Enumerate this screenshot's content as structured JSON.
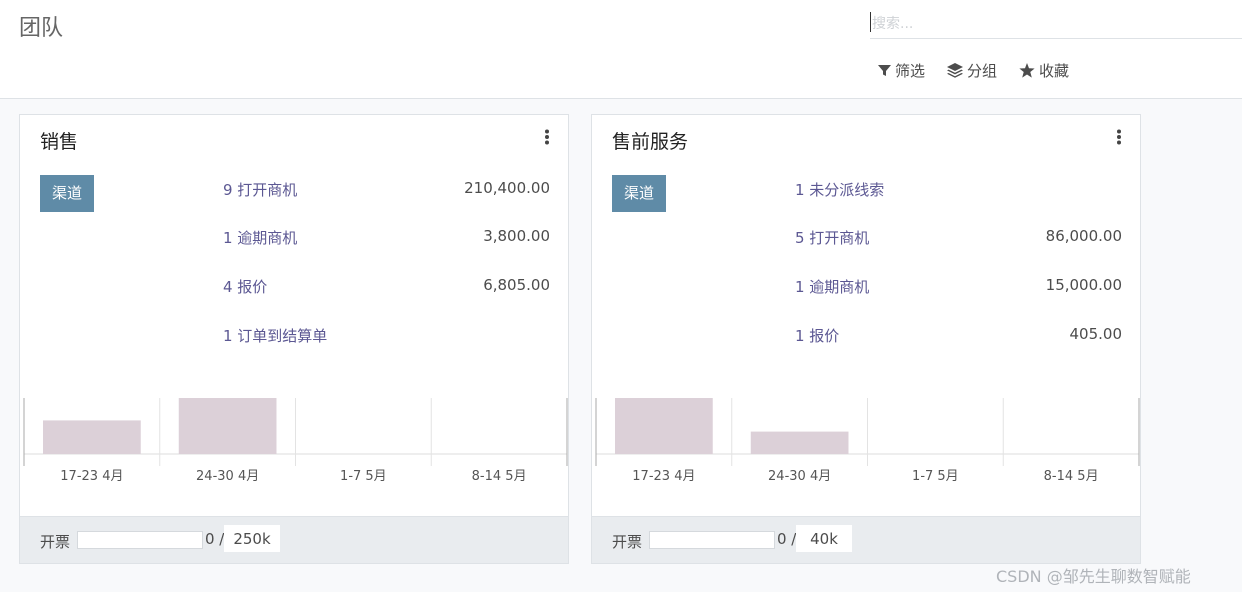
{
  "page_title": "团队",
  "search": {
    "placeholder": "搜索..."
  },
  "filters": [
    {
      "label": "筛选",
      "icon": "filter-icon"
    },
    {
      "label": "分组",
      "icon": "layers-icon"
    },
    {
      "label": "收藏",
      "icon": "star-icon"
    }
  ],
  "colors": {
    "channel_button": "#5f8ba7",
    "link": "#5c5893",
    "bar": "#dcd0d8"
  },
  "cards": [
    {
      "title": "销售",
      "channel_label": "渠道",
      "rows": [
        {
          "label": "9 打开商机",
          "amount": "210,400.00"
        },
        {
          "label": "1 逾期商机",
          "amount": "3,800.00"
        },
        {
          "label": "4 报价",
          "amount": "6,805.00"
        },
        {
          "label": "1 订单到结算单",
          "amount": ""
        }
      ],
      "chart_data": {
        "type": "bar",
        "categories": [
          "17-23 4月",
          "24-30 4月",
          "1-7 5月",
          "8-14 5月"
        ],
        "values": [
          0.6,
          1.0,
          0,
          0
        ]
      },
      "footer": {
        "label": "开票",
        "current": "0 /",
        "target": "250k",
        "progress": 0
      }
    },
    {
      "title": "售前服务",
      "channel_label": "渠道",
      "rows": [
        {
          "label": "1 未分派线索",
          "amount": ""
        },
        {
          "label": "5 打开商机",
          "amount": "86,000.00"
        },
        {
          "label": "1 逾期商机",
          "amount": "15,000.00"
        },
        {
          "label": "1 报价",
          "amount": "405.00"
        }
      ],
      "chart_data": {
        "type": "bar",
        "categories": [
          "17-23 4月",
          "24-30 4月",
          "1-7 5月",
          "8-14 5月"
        ],
        "values": [
          1.0,
          0.4,
          0,
          0
        ]
      },
      "footer": {
        "label": "开票",
        "current": "0 /",
        "target": "40k",
        "progress": 0
      }
    }
  ],
  "watermark": "CSDN @邹先生聊数智赋能"
}
